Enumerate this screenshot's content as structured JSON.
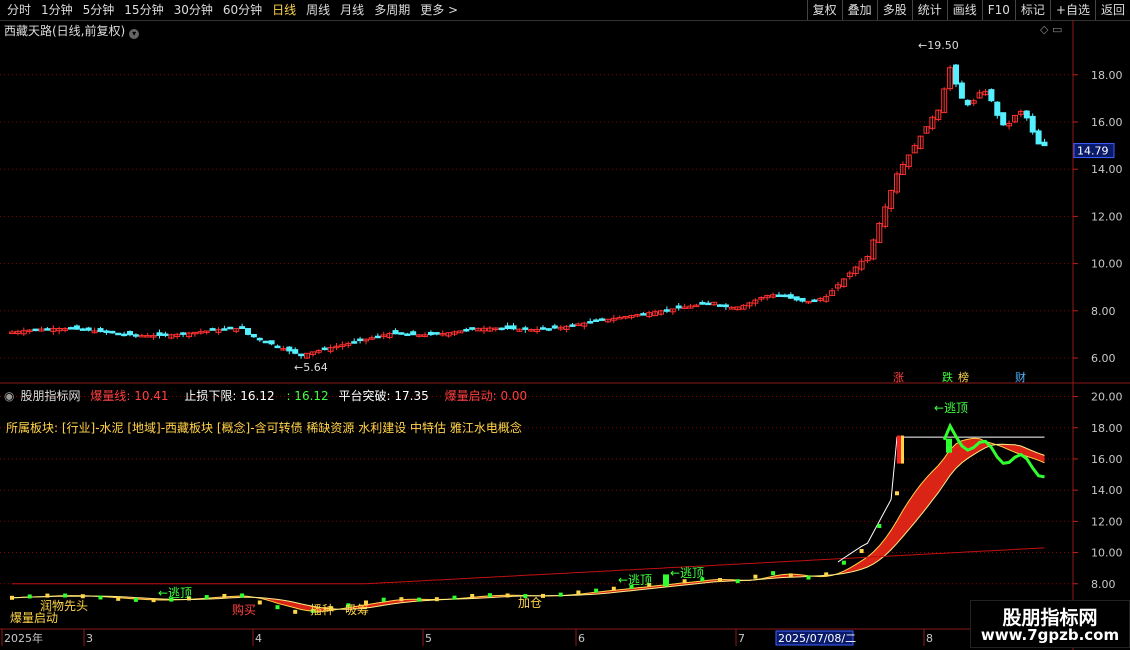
{
  "toolbar": {
    "periods": [
      "分时",
      "1分钟",
      "5分钟",
      "15分钟",
      "30分钟",
      "60分钟",
      "日线",
      "周线",
      "月线",
      "多周期",
      "更多 >"
    ],
    "active_index": 6,
    "right_buttons": [
      "复权",
      "叠加",
      "多股",
      "统计",
      "画线",
      "F10",
      "标记",
      "+自选",
      "返回"
    ]
  },
  "chart_title": "西藏天路(日线,前复权)",
  "main_axis": {
    "ticks": [
      "18.00",
      "16.00",
      "14.00",
      "12.00",
      "10.00",
      "8.00",
      "6.00"
    ],
    "current_price": "14.79"
  },
  "annotations": {
    "high_label": "19.50",
    "low_label": "5.64",
    "tags": [
      {
        "text": "涨",
        "color": "#ff4040"
      },
      {
        "text": "跌",
        "color": "#40ff40"
      },
      {
        "text": "榜",
        "color": "#ffd54a"
      },
      {
        "text": "财",
        "color": "#4fb4ff"
      }
    ]
  },
  "indicator": {
    "name": "股朋指标网",
    "baoliang_label": "爆量线",
    "baoliang_value": "10.41",
    "stop_label": "止损下限",
    "stop_value": "16.12",
    "stop_value2": ": 16.12",
    "platform_label": "平台突破",
    "platform_value": "17.35",
    "start_label": "爆量启动",
    "start_value": "0.00",
    "sector_text": "所属板块: [行业]-水泥 [地域]-西藏板块 [概念]-含可转债 稀缺资源 水利建设 中特估 雅江水电概念",
    "axis_ticks": [
      "20.00",
      "18.00",
      "16.00",
      "14.00",
      "12.00",
      "10.00",
      "8.00"
    ],
    "signals": [
      {
        "text": "爆量启动",
        "color": "#ffd54a"
      },
      {
        "text": "润物先头",
        "color": "#ffd54a"
      },
      {
        "text": "←逃顶",
        "color": "#40ff40"
      },
      {
        "text": "购买",
        "color": "#ff4040"
      },
      {
        "text": "播种",
        "color": "#ffd54a"
      },
      {
        "text": "吸筹",
        "color": "#ffd54a"
      },
      {
        "text": "加仓",
        "color": "#ffd54a"
      },
      {
        "text": "←逃顶",
        "color": "#40ff40"
      },
      {
        "text": "←逃顶",
        "color": "#40ff40"
      },
      {
        "text": "←逃顶",
        "color": "#40ff40"
      }
    ]
  },
  "time_axis": {
    "labels": [
      "2025年",
      "3",
      "4",
      "5",
      "6",
      "7",
      "8"
    ],
    "highlight": "2025/07/08/二"
  },
  "watermark": {
    "line1": "股朋指标网",
    "line2": "www.7gpzb.com"
  },
  "colors": {
    "up": "#ff3030",
    "down": "#54f0ff",
    "grid": "#8b0000",
    "accent": "#ffd54a",
    "green": "#30ff30"
  }
}
